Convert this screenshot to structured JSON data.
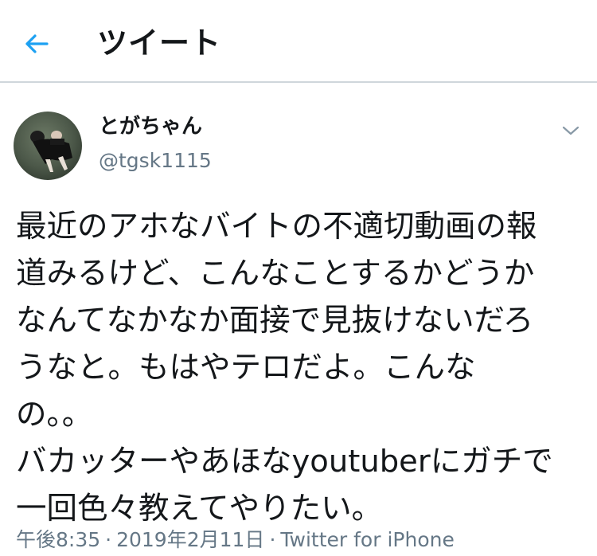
{
  "header": {
    "title": "ツイート",
    "back_icon": "arrow-left-icon",
    "accent_color": "#1da1f2"
  },
  "author": {
    "name": "とがちゃん",
    "handle": "@tgsk1115",
    "avatar_icon": "user-avatar-photo",
    "more_icon": "chevron-down-icon"
  },
  "tweet": {
    "lines": [
      "最近のアホなバイトの不適切動画の報",
      "道みるけど、こんなことするかどうか",
      "なんてなかなか面接で見抜けないだろ",
      "うなと。もはやテロだよ。こんな",
      "の。。",
      "バカッターやあほなyoutuberにガチで",
      "一回色々教えてやりたい。"
    ]
  },
  "meta": {
    "time": "午後8:35",
    "date": "2019年2月11日",
    "source": "Twitter for iPhone",
    "separator": "·"
  }
}
